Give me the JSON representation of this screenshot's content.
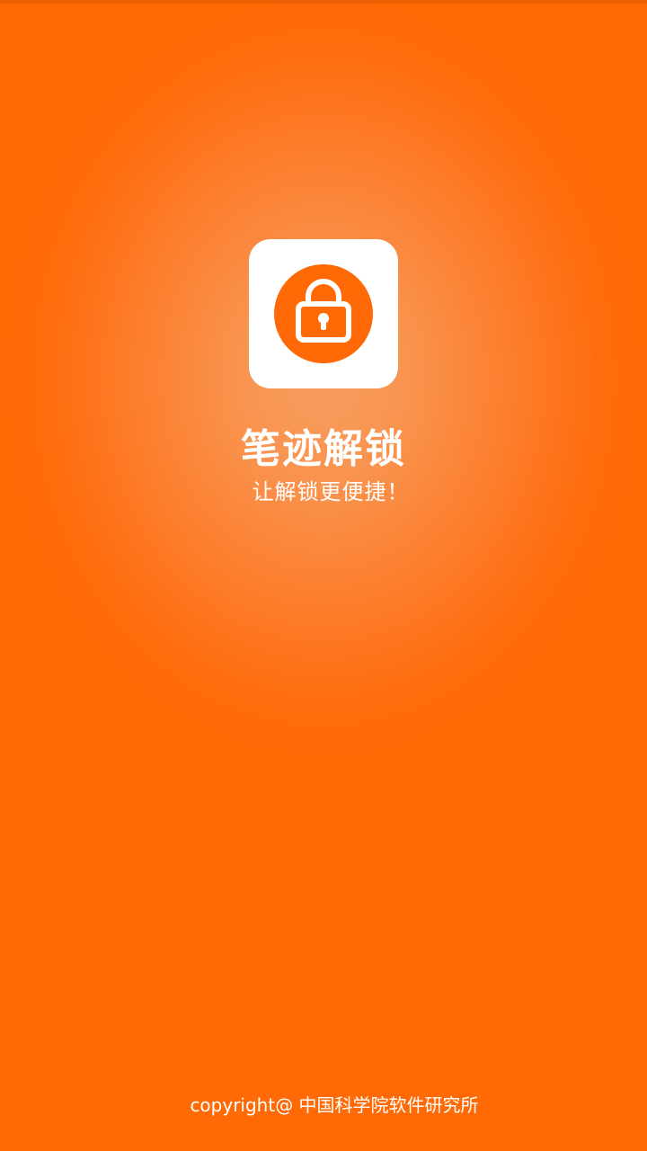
{
  "splash": {
    "app_name": "笔迹解锁",
    "slogan": "让解锁更便捷！",
    "copyright": "copyright@ 中国科学院软件研究所",
    "icon": "padlock-icon"
  },
  "colors": {
    "background": "#ff6a06",
    "glow_center": "#f89e60",
    "icon_circle": "#ff6a06",
    "icon_tile": "#ffffff",
    "text": "#ffffff"
  }
}
